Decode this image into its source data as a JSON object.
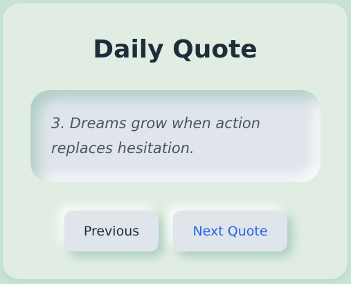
{
  "card": {
    "title": "Daily Quote",
    "quote": "3. Dreams grow when action replaces hesitation."
  },
  "controls": {
    "previous_label": "Previous",
    "next_label": "Next Quote"
  },
  "colors": {
    "background": "#c9e3d6",
    "card": "#e1ede2",
    "surface": "#e0e5ec",
    "title": "#1f2d3a",
    "quote_text": "#4b5563",
    "accent": "#2563eb"
  }
}
